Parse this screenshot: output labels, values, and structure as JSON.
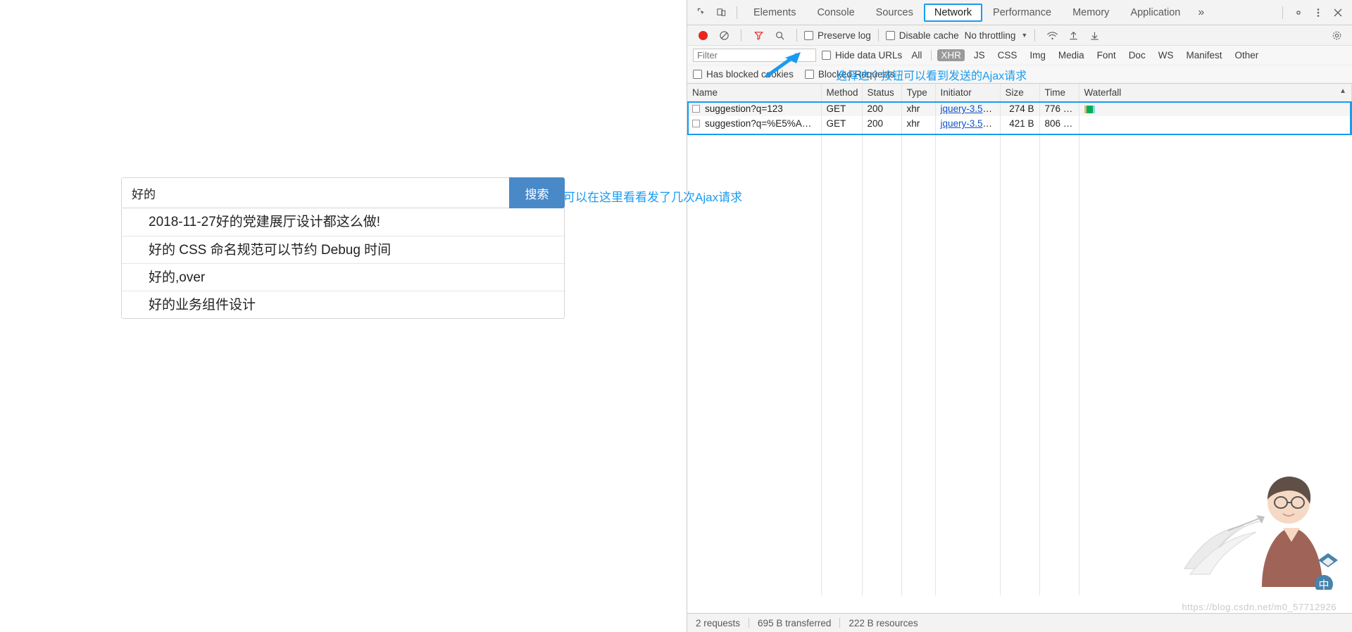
{
  "webpage": {
    "search": {
      "value": "好的",
      "placeholder": "",
      "button_label": "搜索"
    },
    "suggestions": [
      "2018-11-27好的党建展厅设计都这么做!",
      "好的 CSS 命名规范可以节约 Debug 时间",
      "好的,over",
      "好的业务组件设计"
    ]
  },
  "devtools": {
    "tabs": [
      {
        "label": "Elements",
        "active": false
      },
      {
        "label": "Console",
        "active": false
      },
      {
        "label": "Sources",
        "active": false
      },
      {
        "label": "Network",
        "active": true
      },
      {
        "label": "Performance",
        "active": false
      },
      {
        "label": "Memory",
        "active": false
      },
      {
        "label": "Application",
        "active": false
      }
    ],
    "more_tabs_label": "»",
    "icons": {
      "inspect": "inspect-element-icon",
      "device": "device-toolbar-icon",
      "settings": "gear-icon",
      "kebab": "more-options-icon",
      "close": "close-icon",
      "record": "record-icon",
      "clear": "clear-icon",
      "filter": "filter-icon",
      "search": "search-icon",
      "import": "import-har-icon",
      "export": "export-har-icon",
      "wifi": "network-conditions-icon"
    },
    "toolbar": {
      "preserve_log_label": "Preserve log",
      "preserve_log_checked": false,
      "disable_cache_label": "Disable cache",
      "disable_cache_checked": false,
      "throttling_label": "No throttling"
    },
    "filter_row": {
      "filter_placeholder": "Filter",
      "filter_value": "",
      "hide_data_urls_label": "Hide data URLs",
      "hide_data_urls_checked": false,
      "types": [
        {
          "label": "All",
          "active": false
        },
        {
          "label": "XHR",
          "active": true
        },
        {
          "label": "JS",
          "active": false
        },
        {
          "label": "CSS",
          "active": false
        },
        {
          "label": "Img",
          "active": false
        },
        {
          "label": "Media",
          "active": false
        },
        {
          "label": "Font",
          "active": false
        },
        {
          "label": "Doc",
          "active": false
        },
        {
          "label": "WS",
          "active": false
        },
        {
          "label": "Manifest",
          "active": false
        },
        {
          "label": "Other",
          "active": false
        }
      ]
    },
    "blocked_row": {
      "has_blocked_cookies_label": "Has blocked cookies",
      "has_blocked_cookies_checked": false,
      "blocked_requests_label": "Blocked Requests",
      "blocked_requests_checked": false
    },
    "table": {
      "columns": [
        "Name",
        "Method",
        "Status",
        "Type",
        "Initiator",
        "Size",
        "Time",
        "Waterfall"
      ],
      "rows": [
        {
          "name": "suggestion?q=123",
          "method": "GET",
          "status": "200",
          "type": "xhr",
          "initiator": "jquery-3.5.1....",
          "size": "274 B",
          "time": "776 ms"
        },
        {
          "name": "suggestion?q=%E5%A5%B...",
          "method": "GET",
          "status": "200",
          "type": "xhr",
          "initiator": "jquery-3.5.1....",
          "size": "421 B",
          "time": "806 ms"
        }
      ]
    },
    "status_bar": {
      "requests": "2 requests",
      "transferred": "695 B transferred",
      "resources": "222 B resources"
    }
  },
  "annotations": [
    {
      "text": "选择这个按钮可以看到发送的Ajax请求",
      "color": "#1a9bf0"
    },
    {
      "text": "可以在这里看看发了几次Ajax请求",
      "color": "#1a9bf0"
    }
  ],
  "watermark": {
    "url": "https://blog.csdn.net/m0_57712926"
  },
  "colors": {
    "accent": "#1a9bf0",
    "search_button": "#4a89c8",
    "record": "#e8251f",
    "active_filter": "#9a9a9a",
    "link": "#1155cc",
    "waterfall_green": "#00b050"
  }
}
